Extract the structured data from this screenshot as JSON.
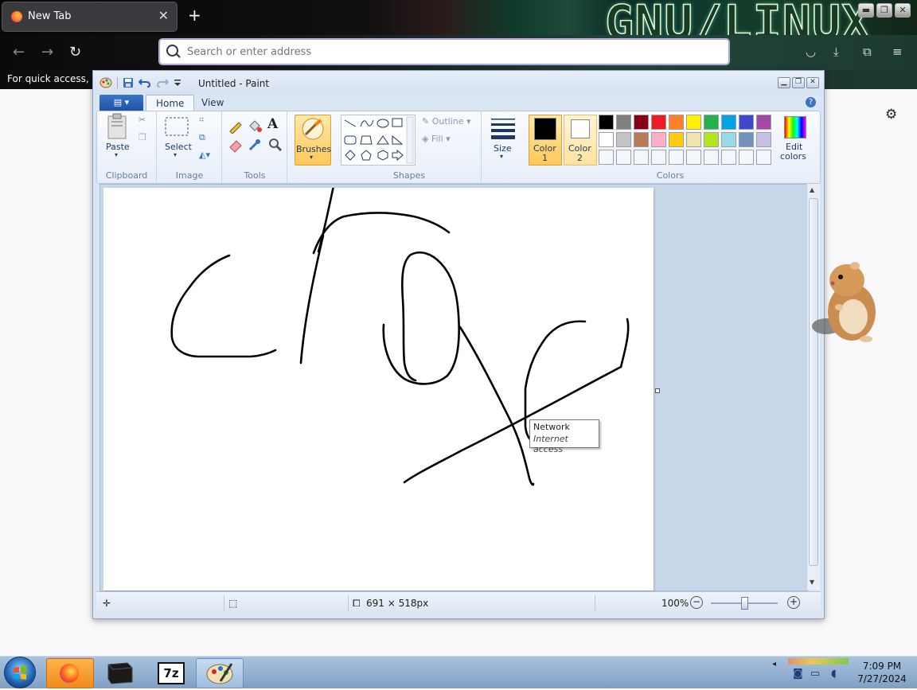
{
  "browser": {
    "tab_title": "New Tab",
    "tab_close": "✕",
    "new_tab": "+",
    "banner_text": "GNU/LINUX",
    "nav_back": "←",
    "nav_forward": "→",
    "nav_reload": "↻",
    "url_placeholder": "Search or enter address",
    "bookmarks_text": "For quick access, pl",
    "settings_icon": "gear-icon",
    "menu_icon": "≡"
  },
  "paint": {
    "title": "Untitled - Paint",
    "tabs": {
      "home": "Home",
      "view": "View"
    },
    "help": "?",
    "groups": {
      "clipboard": "Clipboard",
      "image": "Image",
      "tools": "Tools",
      "shapes": "Shapes",
      "colors": "Colors"
    },
    "buttons": {
      "paste": "Paste",
      "select": "Select",
      "brushes": "Brushes",
      "outline": "Outline",
      "fill": "Fill",
      "size": "Size",
      "color1": "Color",
      "color1_num": "1",
      "color2": "Color",
      "color2_num": "2",
      "edit_colors_1": "Edit",
      "edit_colors_2": "colors"
    },
    "palette": [
      "#000000",
      "#7f7f7f",
      "#880015",
      "#ed1c24",
      "#ff7f27",
      "#fff200",
      "#22b14c",
      "#00a2e8",
      "#3f48cc",
      "#a349a4",
      "#ffffff",
      "#c3c3c3",
      "#b97a57",
      "#ffaec9",
      "#ffc90e",
      "#efe4b0",
      "#b5e61d",
      "#99d9ea",
      "#7092be",
      "#c8bfe7"
    ],
    "color1_value": "#000000",
    "color2_value": "#ffffff",
    "status": {
      "size": "691 × 518px",
      "zoom": "100%"
    },
    "tooltip": {
      "title": "Network",
      "subtitle": "Internet access"
    }
  },
  "taskbar": {
    "time": "7:09 PM",
    "date": "7/27/2024",
    "apps": [
      "firefox-icon",
      "terminal-icon",
      "7zip-icon",
      "paint-icon"
    ],
    "sevenzip_label": "7z"
  }
}
